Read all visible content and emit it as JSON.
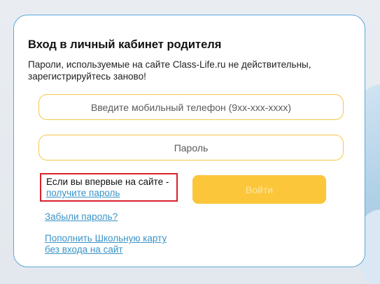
{
  "login": {
    "title": "Вход в личный кабинет родителя",
    "notice": "Пароли, используемые на сайте Class-Life.ru не действительны, зарегистрируйтесь заново!",
    "phone_placeholder": "Введите мобильный телефон (9хх-ххх-хххх)",
    "password_placeholder": "Пароль",
    "first_time_text": "Если вы впервые на сайте -",
    "get_password_link": "получите пароль",
    "login_button": "Войти",
    "forgot_password_link": "Забыли пароль?",
    "topup_link_line1": "Пополнить Школьную карту",
    "topup_link_line2": "без входа на сайт"
  },
  "colors": {
    "card_border": "#5ba7d8",
    "field_border": "#f3c84a",
    "button_bg": "#fbc63a",
    "link": "#3a93c7",
    "highlight_border": "#d9212c"
  }
}
